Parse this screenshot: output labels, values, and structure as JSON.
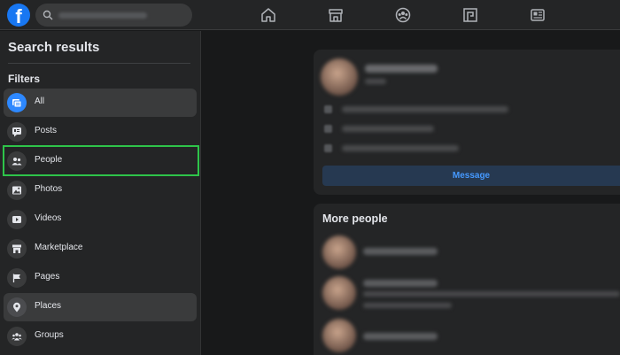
{
  "sidebar": {
    "title": "Search results",
    "filters_label": "Filters",
    "items": [
      {
        "label": "All",
        "icon": "feed-icon"
      },
      {
        "label": "Posts",
        "icon": "posts-icon"
      },
      {
        "label": "People",
        "icon": "people-icon"
      },
      {
        "label": "Photos",
        "icon": "photos-icon"
      },
      {
        "label": "Videos",
        "icon": "videos-icon"
      },
      {
        "label": "Marketplace",
        "icon": "marketplace-icon"
      },
      {
        "label": "Pages",
        "icon": "flag-icon"
      },
      {
        "label": "Places",
        "icon": "location-pin-icon"
      },
      {
        "label": "Groups",
        "icon": "groups-icon"
      }
    ]
  },
  "header": {
    "logo": "f",
    "nav_icons": [
      "home-icon",
      "marketplace-icon",
      "groups-icon",
      "gaming-icon",
      "news-icon"
    ]
  },
  "result_card": {
    "message_label": "Message"
  },
  "more_people": {
    "title": "More people"
  },
  "colors": {
    "accent": "#1877f2",
    "highlight": "#2ec44a",
    "background": "#18191a",
    "surface": "#242526"
  }
}
